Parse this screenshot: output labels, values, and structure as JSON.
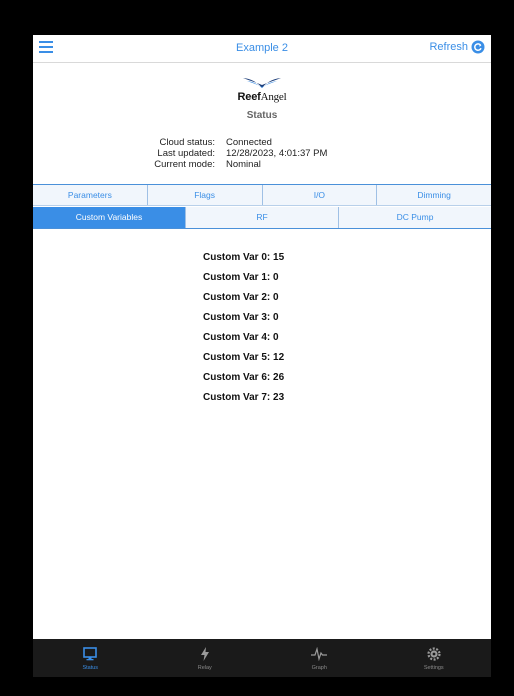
{
  "navbar": {
    "title": "Example 2",
    "refresh_label": "Refresh"
  },
  "logo": {
    "reef": "Reef",
    "angel": "Angel"
  },
  "page": {
    "subtitle": "Status"
  },
  "status_info": [
    {
      "label": "Cloud status:",
      "value": "Connected"
    },
    {
      "label": "Last updated:",
      "value": "12/28/2023, 4:01:37 PM"
    },
    {
      "label": "Current mode:",
      "value": "Nominal"
    }
  ],
  "tabs_row1": [
    "Parameters",
    "Flags",
    "I/O",
    "Dimming"
  ],
  "tabs_row2": [
    "Custom Variables",
    "RF",
    "DC Pump"
  ],
  "active_tab": "Custom Variables",
  "custom_variables": [
    {
      "label": "Custom Var 0:",
      "value": "15"
    },
    {
      "label": "Custom Var 1:",
      "value": "0"
    },
    {
      "label": "Custom Var 2:",
      "value": "0"
    },
    {
      "label": "Custom Var 3:",
      "value": "0"
    },
    {
      "label": "Custom Var 4:",
      "value": "0"
    },
    {
      "label": "Custom Var 5:",
      "value": "12"
    },
    {
      "label": "Custom Var 6:",
      "value": "26"
    },
    {
      "label": "Custom Var 7:",
      "value": "23"
    }
  ],
  "tabbar": [
    {
      "label": "Status",
      "icon": "monitor-icon",
      "active": true
    },
    {
      "label": "Relay",
      "icon": "lightning-icon",
      "active": false
    },
    {
      "label": "Graph",
      "icon": "pulse-icon",
      "active": false
    },
    {
      "label": "Settings",
      "icon": "gear-icon",
      "active": false
    }
  ],
  "colors": {
    "accent": "#3a8ee6",
    "tabbar_bg": "#1a1a1a"
  }
}
